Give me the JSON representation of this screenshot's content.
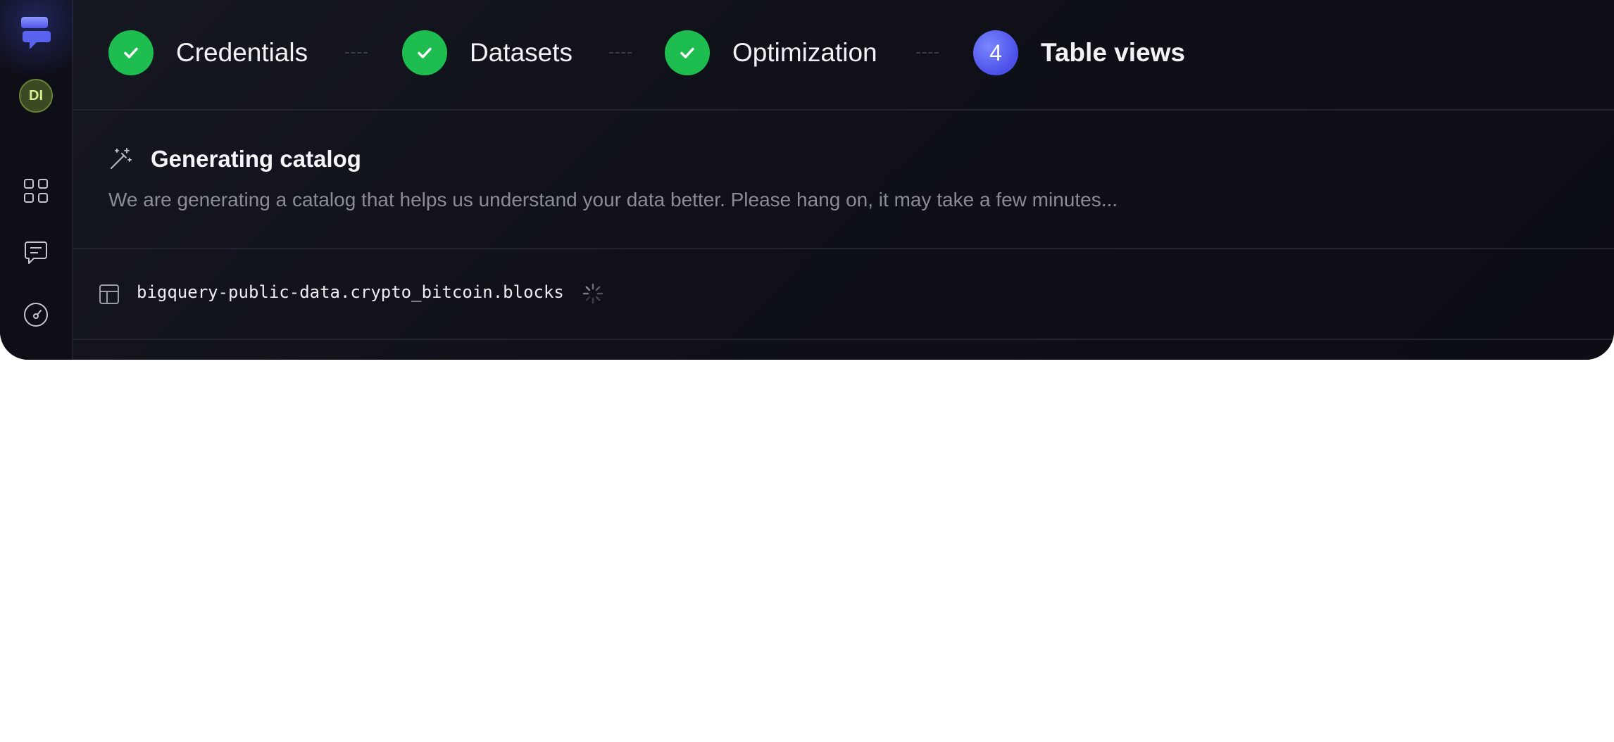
{
  "sidebar": {
    "logo_icon": "app-logo-icon",
    "avatar_initials": "DI",
    "items": [
      {
        "icon": "grid-icon"
      },
      {
        "icon": "chat-icon"
      },
      {
        "icon": "gauge-icon"
      }
    ]
  },
  "stepper": {
    "steps": [
      {
        "number": "1",
        "label": "Credentials",
        "status": "complete",
        "icon": "check-icon"
      },
      {
        "number": "2",
        "label": "Datasets",
        "status": "complete",
        "icon": "check-icon"
      },
      {
        "number": "3",
        "label": "Optimization",
        "status": "complete",
        "icon": "check-icon"
      },
      {
        "number": "4",
        "label": "Table views",
        "status": "active"
      }
    ]
  },
  "catalog": {
    "icon": "magic-wand-icon",
    "title": "Generating catalog",
    "description": "We are generating a catalog that helps us understand your data better. Please hang on, it may take a few minutes..."
  },
  "tables": [
    {
      "icon": "table-icon",
      "name": "bigquery-public-data.crypto_bitcoin.blocks",
      "status": "loading"
    }
  ],
  "colors": {
    "background": "#0e0f17",
    "complete": "#1dbd4f",
    "active": "#4b4fe8",
    "muted_text": "#8b8d96"
  }
}
